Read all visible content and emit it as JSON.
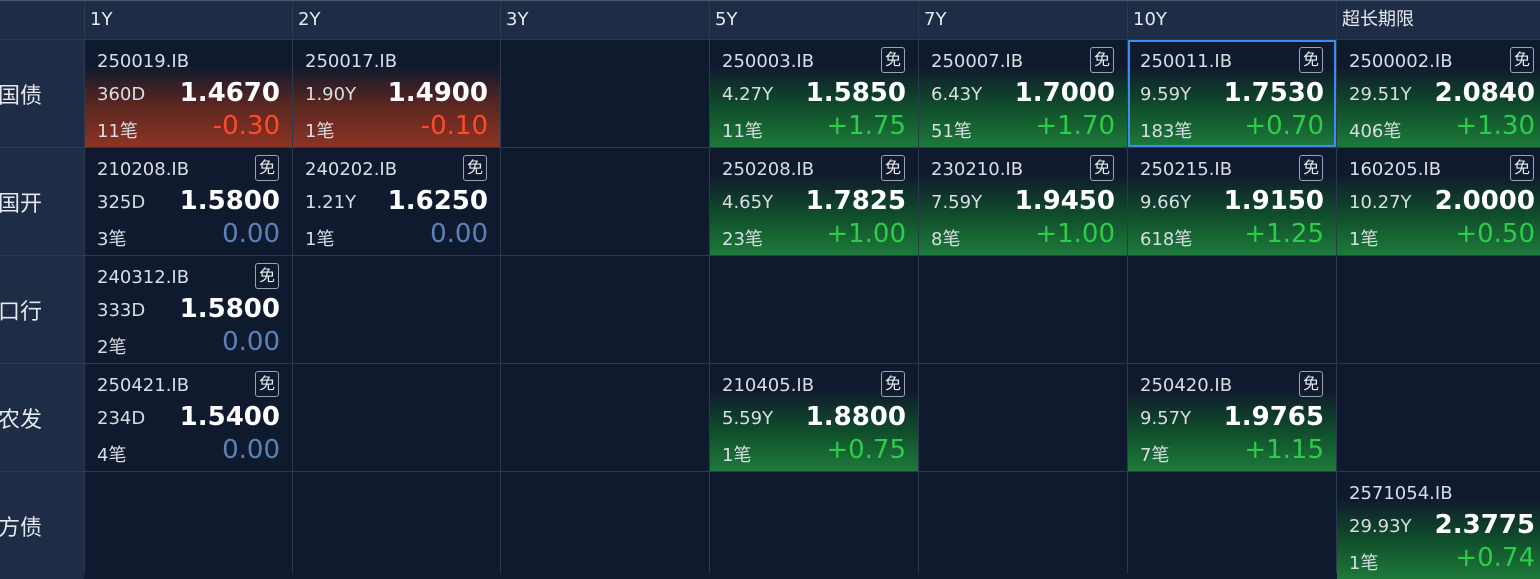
{
  "columns": [
    "1Y",
    "2Y",
    "3Y",
    "5Y",
    "7Y",
    "10Y",
    "超长期限"
  ],
  "rows": [
    {
      "label": "国债",
      "cells": [
        {
          "code": "250019.IB",
          "badge": "",
          "tenor": "360D",
          "yield": "1.4670",
          "trades": "11笔",
          "change": "-0.30",
          "trend": "down",
          "selected": false
        },
        {
          "code": "250017.IB",
          "badge": "",
          "tenor": "1.90Y",
          "yield": "1.4900",
          "trades": "1笔",
          "change": "-0.10",
          "trend": "down",
          "selected": false
        },
        null,
        {
          "code": "250003.IB",
          "badge": "免",
          "tenor": "4.27Y",
          "yield": "1.5850",
          "trades": "11笔",
          "change": "+1.75",
          "trend": "up",
          "selected": false
        },
        {
          "code": "250007.IB",
          "badge": "免",
          "tenor": "6.43Y",
          "yield": "1.7000",
          "trades": "51笔",
          "change": "+1.70",
          "trend": "up",
          "selected": false
        },
        {
          "code": "250011.IB",
          "badge": "免",
          "tenor": "9.59Y",
          "yield": "1.7530",
          "trades": "183笔",
          "change": "+0.70",
          "trend": "up",
          "selected": true
        },
        {
          "code": "2500002.IB",
          "badge": "免",
          "tenor": "29.51Y",
          "yield": "2.0840",
          "trades": "406笔",
          "change": "+1.30",
          "trend": "up",
          "selected": false
        }
      ]
    },
    {
      "label": "国开",
      "cells": [
        {
          "code": "210208.IB",
          "badge": "免",
          "tenor": "325D",
          "yield": "1.5800",
          "trades": "3笔",
          "change": "0.00",
          "trend": "flat",
          "selected": false
        },
        {
          "code": "240202.IB",
          "badge": "免",
          "tenor": "1.21Y",
          "yield": "1.6250",
          "trades": "1笔",
          "change": "0.00",
          "trend": "flat",
          "selected": false
        },
        null,
        {
          "code": "250208.IB",
          "badge": "免",
          "tenor": "4.65Y",
          "yield": "1.7825",
          "trades": "23笔",
          "change": "+1.00",
          "trend": "up",
          "selected": false
        },
        {
          "code": "230210.IB",
          "badge": "免",
          "tenor": "7.59Y",
          "yield": "1.9450",
          "trades": "8笔",
          "change": "+1.00",
          "trend": "up",
          "selected": false
        },
        {
          "code": "250215.IB",
          "badge": "免",
          "tenor": "9.66Y",
          "yield": "1.9150",
          "trades": "618笔",
          "change": "+1.25",
          "trend": "up",
          "selected": false
        },
        {
          "code": "160205.IB",
          "badge": "免",
          "tenor": "10.27Y",
          "yield": "2.0000",
          "trades": "1笔",
          "change": "+0.50",
          "trend": "up",
          "selected": false
        }
      ]
    },
    {
      "label": "口行",
      "cells": [
        {
          "code": "240312.IB",
          "badge": "免",
          "tenor": "333D",
          "yield": "1.5800",
          "trades": "2笔",
          "change": "0.00",
          "trend": "flat",
          "selected": false
        },
        null,
        null,
        null,
        null,
        null,
        null
      ]
    },
    {
      "label": "农发",
      "cells": [
        {
          "code": "250421.IB",
          "badge": "免",
          "tenor": "234D",
          "yield": "1.5400",
          "trades": "4笔",
          "change": "0.00",
          "trend": "flat",
          "selected": false
        },
        null,
        null,
        {
          "code": "210405.IB",
          "badge": "免",
          "tenor": "5.59Y",
          "yield": "1.8800",
          "trades": "1笔",
          "change": "+0.75",
          "trend": "up",
          "selected": false
        },
        null,
        {
          "code": "250420.IB",
          "badge": "免",
          "tenor": "9.57Y",
          "yield": "1.9765",
          "trades": "7笔",
          "change": "+1.15",
          "trend": "up",
          "selected": false
        },
        null
      ]
    },
    {
      "label": "地方债",
      "cells": [
        null,
        null,
        null,
        null,
        null,
        null,
        {
          "code": "2571054.IB",
          "badge": "",
          "tenor": "29.93Y",
          "yield": "2.3775",
          "trades": "1笔",
          "change": "+0.74",
          "trend": "up",
          "selected": false
        }
      ]
    }
  ],
  "colors": {
    "background": "#101a2e",
    "header_background": "#1e2c45",
    "positive": "#2ecc4a",
    "negative": "#ff4a2a",
    "zero": "#5b82b8",
    "selection": "#3b8ef0"
  }
}
